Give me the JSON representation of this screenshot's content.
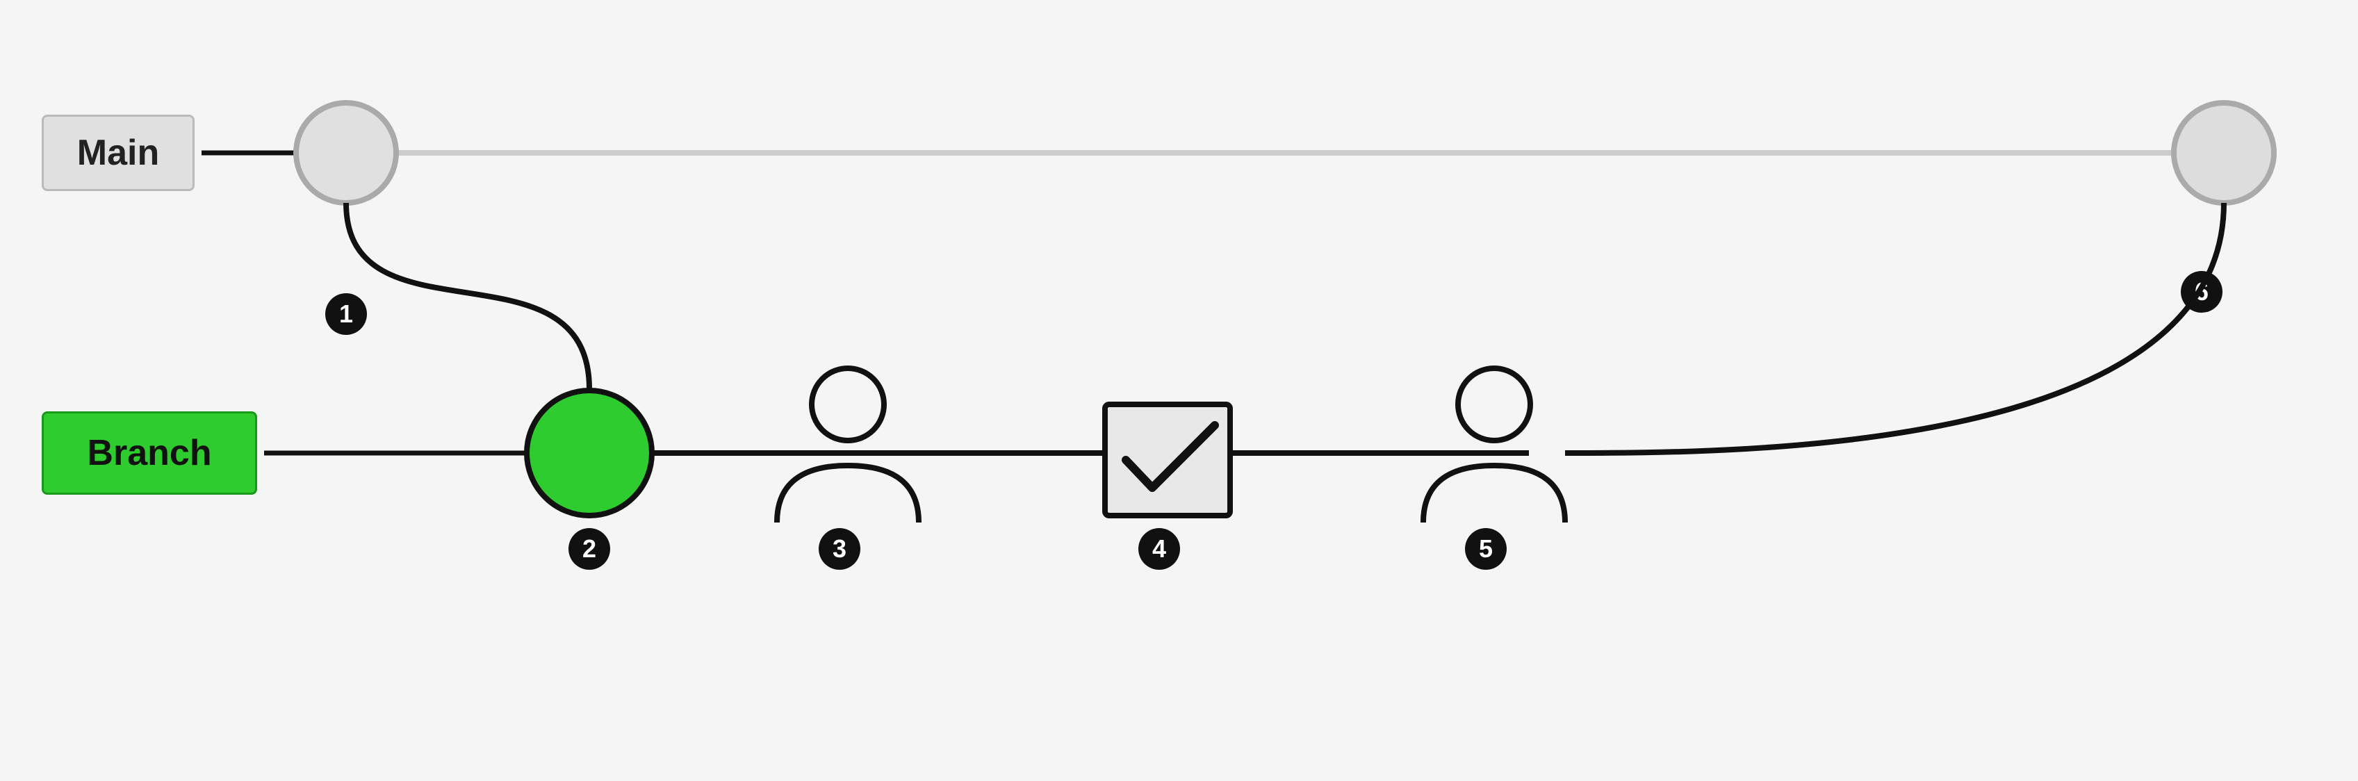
{
  "labels": {
    "main": "Main",
    "branch": "Branch"
  },
  "badges": {
    "one": "1",
    "two": "2",
    "three": "3",
    "four": "4",
    "five": "5",
    "six": "6"
  },
  "colors": {
    "background": "#f5f5f5",
    "main_line": "#cccccc",
    "branch_line": "#111111",
    "main_circle_fill": "#e0e0e0",
    "main_circle_stroke": "#aaaaaa",
    "branch_circle_fill": "#2ecc2e",
    "branch_circle_stroke": "#111111",
    "end_circle_fill": "#dddddd",
    "end_circle_stroke": "#aaaaaa",
    "badge_bg": "#111111",
    "badge_text": "#ffffff"
  }
}
